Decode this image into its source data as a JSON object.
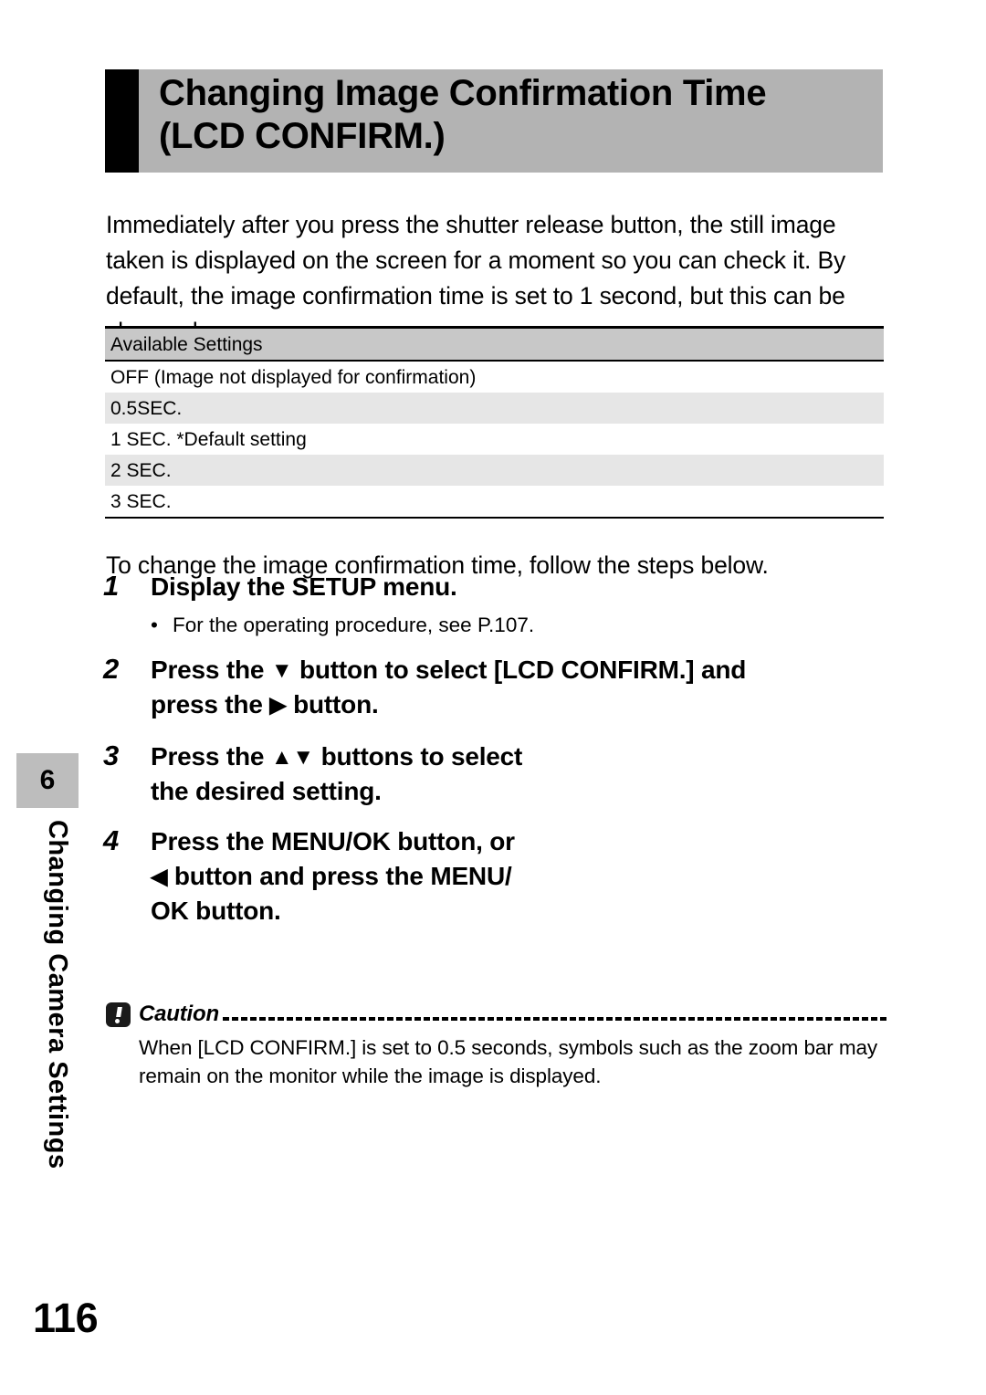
{
  "chapter": {
    "number": "6",
    "title": "Changing Camera Settings"
  },
  "header": {
    "title_line1": "Changing Image Confirmation Time",
    "title_line2": "(LCD CONFIRM.)"
  },
  "intro": {
    "paragraph": "Immediately after you press the shutter release button, the still image taken is displayed on the screen for a moment so you can check it. By default, the image confirmation time is set to 1 second, but this can be changed."
  },
  "settings_table": {
    "header": "Available Settings",
    "rows": [
      "OFF (Image not displayed for confirmation)",
      "0.5SEC.",
      "1 SEC. *Default setting",
      "2 SEC.",
      "3 SEC."
    ]
  },
  "leadin": "To change the image confirmation time, follow the steps below.",
  "steps": [
    {
      "number": "1",
      "line1": "Display the SETUP menu.",
      "line2": "",
      "line3": "",
      "note_bullet": "•",
      "note": "For the operating procedure, see P.107."
    },
    {
      "number": "2",
      "line1_a": "Press the ",
      "icon_down": "▼",
      "line1_b": " button to select [LCD CONFIRM.] and",
      "line2_a": "press the ",
      "icon_right": "▶",
      "line2_b": " button."
    },
    {
      "number": "3",
      "line1_a": "Press the ",
      "icon_up": "▲",
      "icon_down": "▼",
      "line1_b": " buttons to select",
      "line2": "the desired setting."
    },
    {
      "number": "4",
      "line1": "Press the MENU/OK button, or",
      "line2_a": "",
      "icon_left": "◀",
      "line2_b": " button and press the MENU/",
      "line3": "OK button."
    }
  ],
  "caution": {
    "label": "Caution",
    "body": "When [LCD CONFIRM.] is set to 0.5 seconds, symbols such as the zoom bar may remain on the monitor while the image is displayed."
  },
  "page_number": "116",
  "colors": {
    "title_band": "#b3b3b3",
    "table_header": "#c8c8c8",
    "table_stripe": "#e6e6e6",
    "chapter_tab": "#bdbdbd"
  }
}
